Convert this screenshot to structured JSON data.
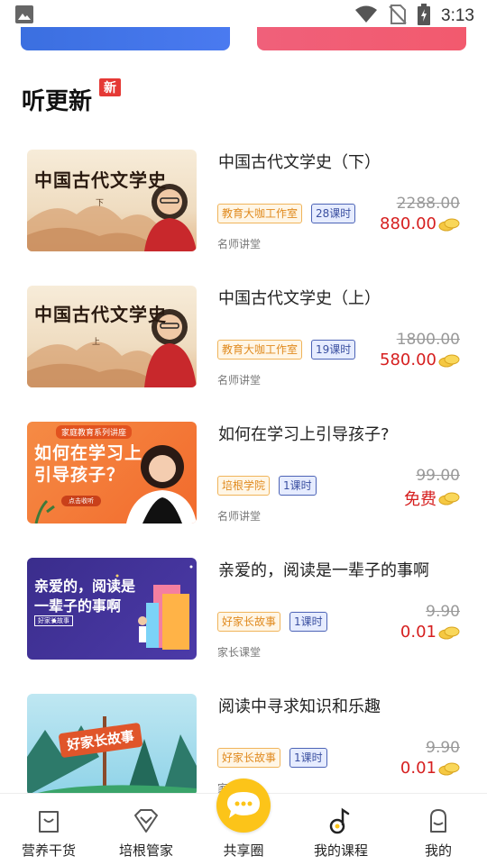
{
  "status_bar": {
    "time": "3:13"
  },
  "section": {
    "title": "听更新",
    "badge": "新"
  },
  "courses": [
    {
      "title": "中国古代文学史（下）",
      "org": "教育大咖工作室",
      "lessons": "28课时",
      "category": "名师讲堂",
      "old_price": "2288.00",
      "price": "880.00",
      "thumb_title": "中国古代文学史",
      "thumb_sub": "下"
    },
    {
      "title": "中国古代文学史（上）",
      "org": "教育大咖工作室",
      "lessons": "19课时",
      "category": "名师讲堂",
      "old_price": "1800.00",
      "price": "580.00",
      "thumb_title": "中国古代文学史",
      "thumb_sub": "上"
    },
    {
      "title": "如何在学习上引导孩子?",
      "org": "培根学院",
      "lessons": "1课时",
      "category": "名师讲堂",
      "old_price": "99.00",
      "price": "免费",
      "thumb_top": "家庭教育系列讲座",
      "thumb_line1": "如何在学习上",
      "thumb_line2": "引导孩子？",
      "thumb_btn": "点击收听"
    },
    {
      "title": "亲爱的，阅读是一辈子的事啊",
      "org": "好家长故事",
      "lessons": "1课时",
      "category": "家长课堂",
      "old_price": "9.90",
      "price": "0.01",
      "thumb_line1": "亲爱的，阅读是",
      "thumb_line2": "一辈子的事啊",
      "thumb_tag": "好家长故事"
    },
    {
      "title": "阅读中寻求知识和乐趣",
      "org": "好家长故事",
      "lessons": "1课时",
      "category": "家长课堂",
      "old_price": "9.90",
      "price": "0.01",
      "thumb_sign": "好家长故事"
    }
  ],
  "bottom_nav": [
    {
      "label": "营养干货",
      "icon": "bag-icon"
    },
    {
      "label": "培根管家",
      "icon": "diamond-icon"
    },
    {
      "label": "共享圈",
      "icon": "chat-bubble-icon"
    },
    {
      "label": "我的课程",
      "icon": "music-note-icon"
    },
    {
      "label": "我的",
      "icon": "user-icon"
    }
  ],
  "colors": {
    "price_red": "#d61f1f",
    "share_yellow": "#fcc419",
    "banner_blue": "#3b6fe0",
    "banner_pink": "#f0607a"
  }
}
